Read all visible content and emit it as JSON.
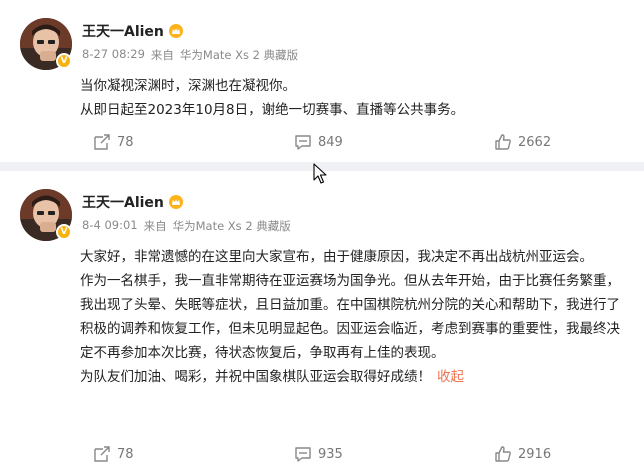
{
  "posts": [
    {
      "username": "王天一Alien",
      "date": "8-27 08:29",
      "source_prefix": "来自",
      "device": "华为Mate Xs 2 典藏版",
      "paragraphs": [
        "当你凝视深渊时，深渊也在凝视你。",
        "从即日起至2023年10月8日，谢绝一切赛事、直播等公共事务。"
      ],
      "reposts": "78",
      "comments": "849",
      "likes": "2662"
    },
    {
      "username": "王天一Alien",
      "date": "8-4 09:01",
      "source_prefix": "来自",
      "device": "华为Mate Xs 2 典藏版",
      "paragraphs": [
        "大家好，非常遗憾的在这里向大家宣布，由于健康原因，我决定不再出战杭州亚运会。",
        "作为一名棋手，我一直非常期待在亚运赛场为国争光。但从去年开始，由于比赛任务繁重，我出现了头晕、失眠等症状，且日益加重。在中国棋院杭州分院的关心和帮助下，我进行了积极的调养和恢复工作，但未见明显起色。因亚运会临近，考虑到赛事的重要性，我最终决定不再参加本次比赛，待状态恢复后，争取再有上佳的表现。",
        "为队友们加油、喝彩，并祝中国象棋队亚运会取得好成绩！"
      ],
      "collapse_label": "收起",
      "reposts": "78",
      "comments": "935",
      "likes": "2916"
    }
  ],
  "colors": {
    "accent_link": "#eb7350",
    "verified_badge": "#f6b30c",
    "background": "#f0f1f4"
  }
}
